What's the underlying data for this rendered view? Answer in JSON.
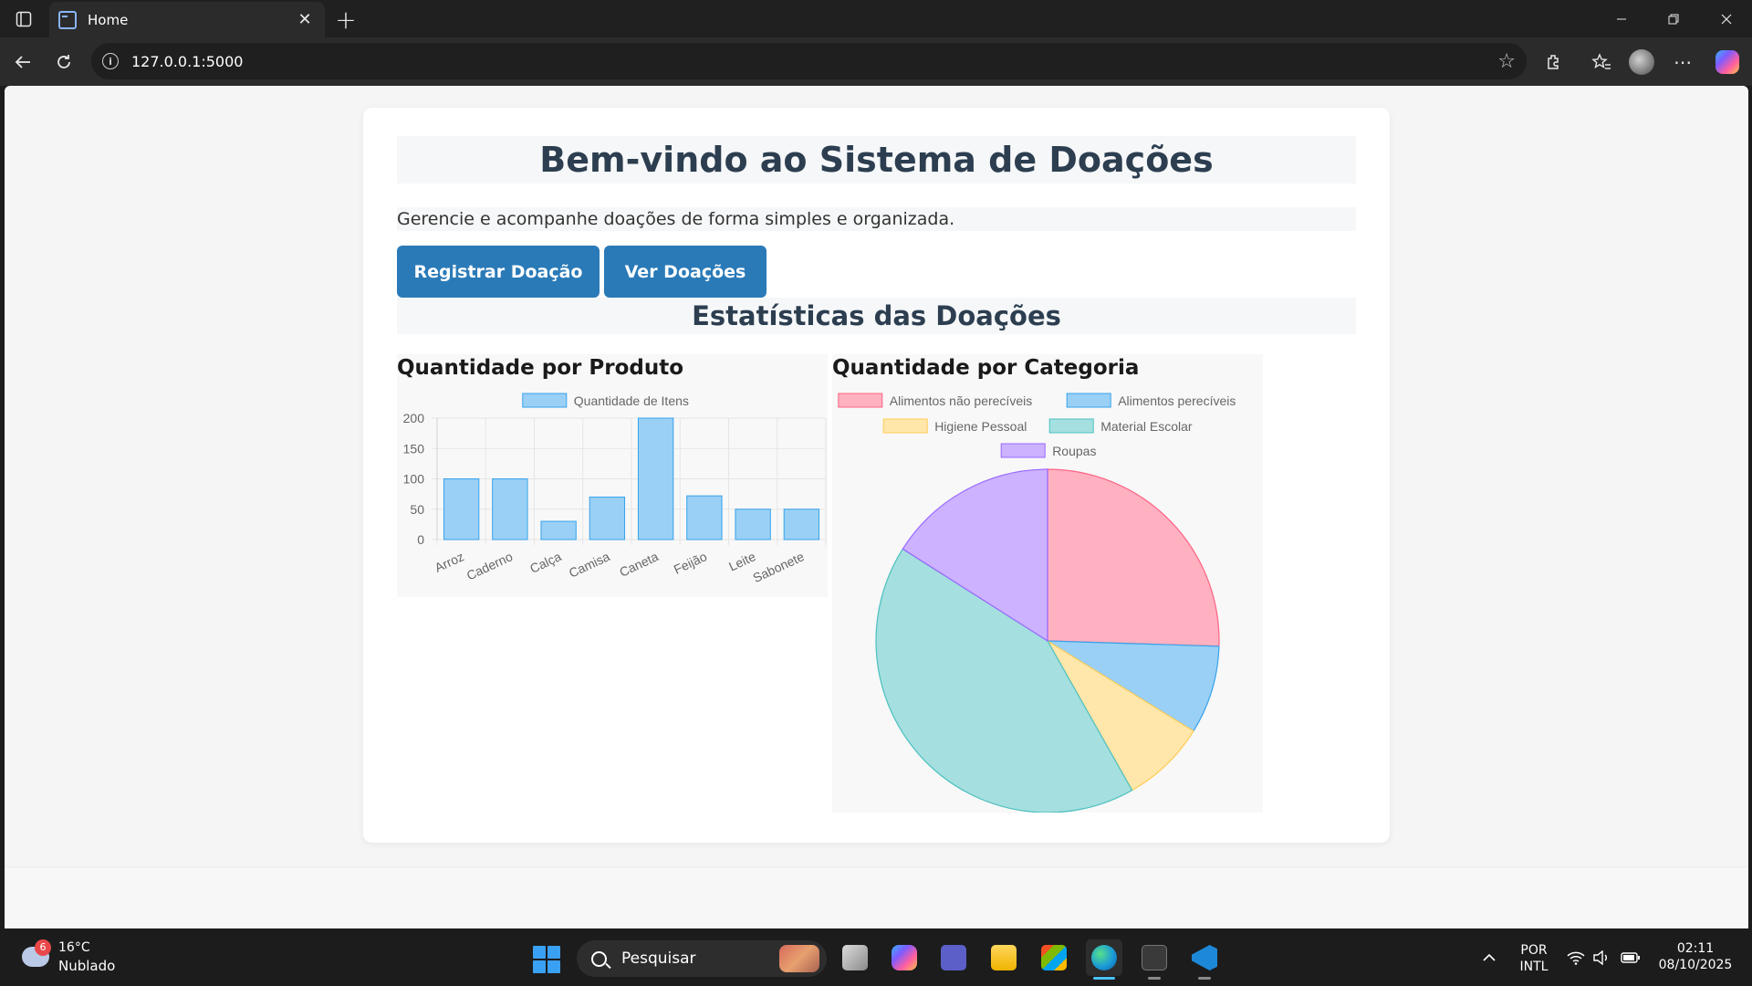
{
  "browser": {
    "tab_title": "Home",
    "url": "127.0.0.1:5000"
  },
  "page": {
    "title": "Bem-vindo ao Sistema de Doações",
    "subtitle": "Gerencie e acompanhe doações de forma simples e organizada.",
    "buttons": {
      "register": "Registrar Doação",
      "view": "Ver Doações"
    },
    "stats_title": "Estatísticas das Doações",
    "colors": {
      "heading": "#2c3e50",
      "button": "#2a7ab8"
    }
  },
  "chart_data": [
    {
      "type": "bar",
      "title": "Quantidade por Produto",
      "categories": [
        "Arroz",
        "Caderno",
        "Calça",
        "Camisa",
        "Caneta",
        "Feijão",
        "Leite",
        "Sabonete"
      ],
      "series": [
        {
          "name": "Quantidade de Itens",
          "values": [
            100,
            100,
            30,
            70,
            200,
            72,
            50,
            50
          ],
          "color": "#9ad0f5",
          "border": "#36a2eb"
        }
      ],
      "ylim": [
        0,
        200
      ],
      "yticks": [
        0,
        50,
        100,
        150,
        200
      ],
      "legend": "top",
      "grid": true
    },
    {
      "type": "pie",
      "title": "Quantidade por Categoria",
      "labels": [
        "Alimentos não perecíveis",
        "Alimentos perecíveis",
        "Higiene Pessoal",
        "Material Escolar",
        "Roupas"
      ],
      "values": [
        25.5,
        8.3,
        8.0,
        42.2,
        16.0
      ],
      "colors": [
        "#ffb1c1",
        "#9ad0f5",
        "#ffe6aa",
        "#a5dfdf",
        "#ccb2ff"
      ],
      "borders": [
        "#ff6384",
        "#36a2eb",
        "#ffcd56",
        "#4bc0c0",
        "#9966ff"
      ],
      "legend": "top"
    }
  ],
  "taskbar": {
    "weather_badge": "6",
    "temperature": "16°C",
    "weather_desc": "Nublado",
    "search_label": "Pesquisar",
    "lang_line1": "POR",
    "lang_line2": "INTL",
    "time": "02:11",
    "date": "08/10/2025"
  }
}
